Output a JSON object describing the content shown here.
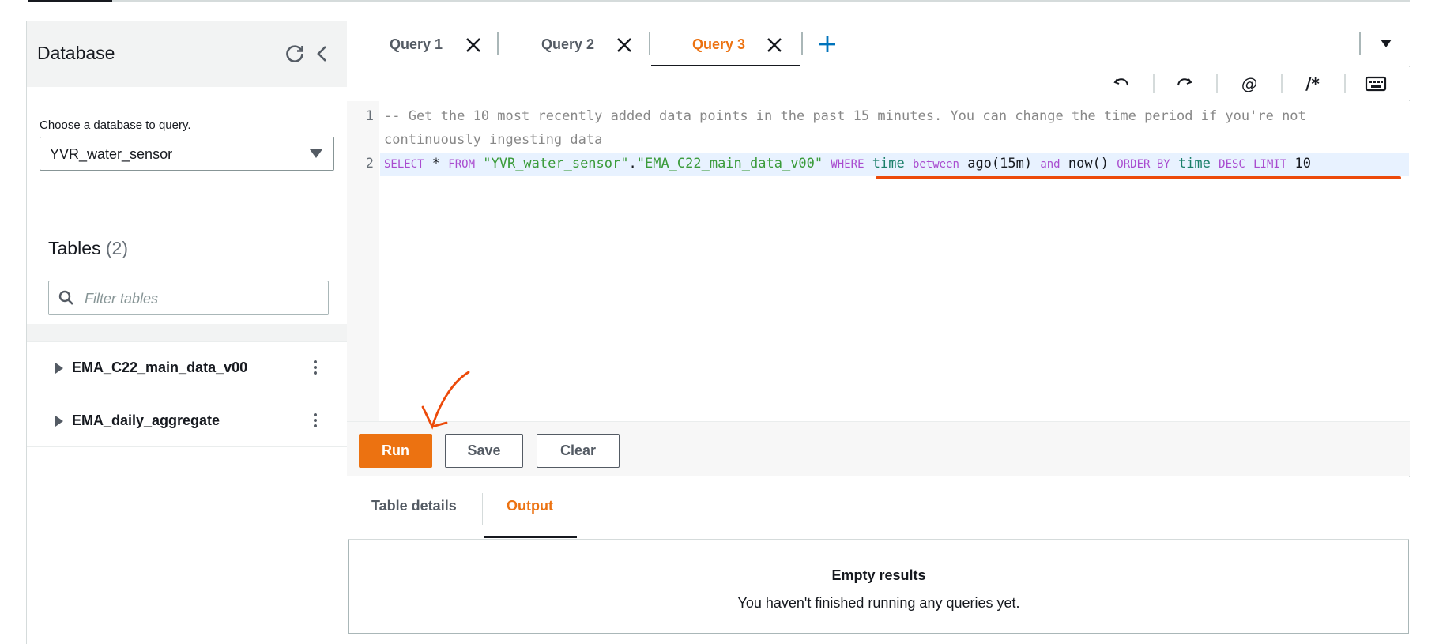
{
  "sidebar": {
    "title": "Database",
    "db_label": "Choose a database to query.",
    "db_selected": "YVR_water_sensor",
    "tables_title": "Tables",
    "tables_count": "(2)",
    "filter_placeholder": "Filter tables",
    "tables": [
      {
        "name": "EMA_C22_main_data_v00"
      },
      {
        "name": "EMA_daily_aggregate"
      }
    ]
  },
  "tabs": [
    {
      "label": "Query 1"
    },
    {
      "label": "Query 2"
    },
    {
      "label": "Query 3"
    }
  ],
  "editor": {
    "line_numbers": [
      "1",
      "2"
    ],
    "line1a": "-- Get the 10 most recently added data points in the past 15 minutes. You can change the time period if you're not",
    "line1b": "continuously ingesting data",
    "line2": {
      "select": "SELECT",
      "star": " * ",
      "from": "FROM",
      "db": " \"YVR_water_sensor\"",
      "dot": ".",
      "table": "\"EMA_C22_main_data_v00\" ",
      "where": "WHERE",
      "time1": " time ",
      "between": "between",
      "ago": " ago(15m) ",
      "and": "and",
      "now": " now() ",
      "order_by": "ORDER BY",
      "time2": " time ",
      "desc": "DESC",
      "sp": " ",
      "limit": "LIMIT",
      "ten": " 10"
    }
  },
  "actions": {
    "run": "Run",
    "save": "Save",
    "clear": "Clear"
  },
  "bottom_tabs": [
    {
      "label": "Table details"
    },
    {
      "label": "Output"
    }
  ],
  "results": {
    "title": "Empty results",
    "message": "You haven't finished running any queries yet."
  },
  "colors": {
    "accent": "#ec7211",
    "annotation": "#ec4a0a"
  }
}
